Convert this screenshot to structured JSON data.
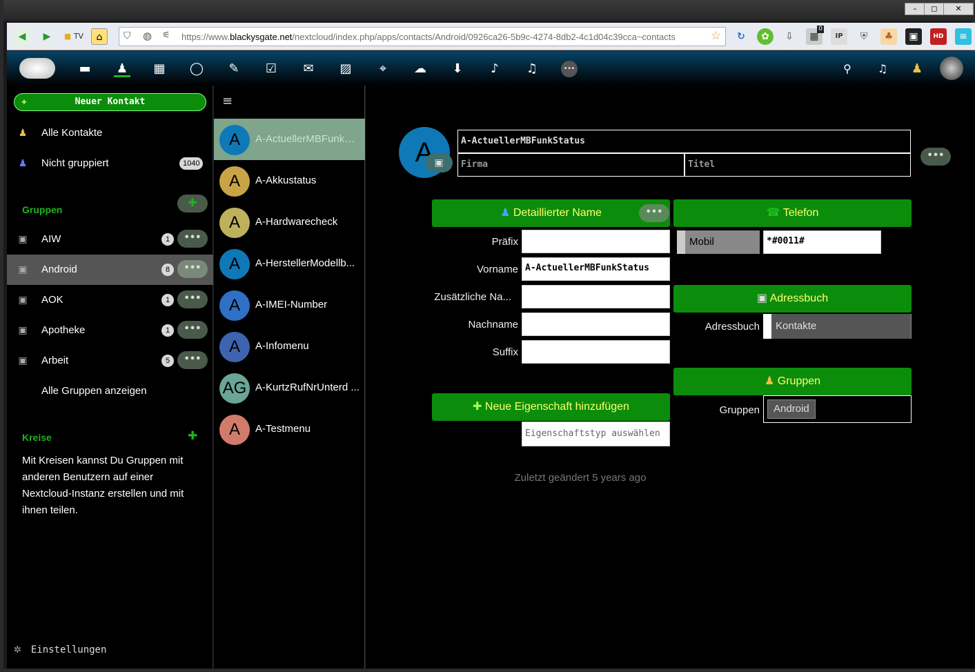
{
  "window": {
    "minimize": "–",
    "maximize": "◻",
    "close": "✕"
  },
  "browser": {
    "tv_label": "TV",
    "url_prefix": "https://www.",
    "url_host": "blackysgate.net",
    "url_path": "/nextcloud/index.php/apps/contacts/Android/0926ca26-5b9c-4274-8db2-4c1d04c39cca~contacts",
    "badge_count": "0",
    "ip_label": "IP",
    "hd_label": "HD"
  },
  "header": {
    "nav_icons": [
      "files-icon",
      "contacts-icon",
      "calendar-icon",
      "talk-icon",
      "notes-icon",
      "tasks-icon",
      "mail-icon",
      "photos-icon",
      "maps-icon",
      "upload-icon",
      "download-icon",
      "audio-icon",
      "music-icon",
      "more-icon"
    ],
    "more_label": "•••"
  },
  "sidebar": {
    "new_contact": "Neuer Kontakt",
    "all_contacts": "Alle Kontakte",
    "ungrouped": "Nicht gruppiert",
    "ungrouped_count": "1040",
    "groups_title": "Gruppen",
    "groups": [
      {
        "label": "AIW",
        "count": "1"
      },
      {
        "label": "Android",
        "count": "8"
      },
      {
        "label": "AOK",
        "count": "1"
      },
      {
        "label": "Apotheke",
        "count": "1"
      },
      {
        "label": "Arbeit",
        "count": "5"
      }
    ],
    "show_all_groups": "Alle Gruppen anzeigen",
    "circles_title": "Kreise",
    "circles_text": "Mit Kreisen kannst Du Gruppen mit anderen Benutzern auf einer Nextcloud-Instanz erstellen und mit ihnen teilen.",
    "settings": "Einstellungen",
    "dots": "•••"
  },
  "contacts": [
    {
      "initials": "A",
      "name": "A-ActuellerMBFunkSt...",
      "color": "#0e79b6"
    },
    {
      "initials": "A",
      "name": "A-Akkustatus",
      "color": "#c9a446"
    },
    {
      "initials": "A",
      "name": "A-Hardwarecheck",
      "color": "#bdb15c"
    },
    {
      "initials": "A",
      "name": "A-HerstellerModellb...",
      "color": "#0e79b6"
    },
    {
      "initials": "A",
      "name": "A-IMEI-Number",
      "color": "#2f6fc6"
    },
    {
      "initials": "A",
      "name": "A-Infomenu",
      "color": "#3e64b0"
    },
    {
      "initials": "AG",
      "name": "A-KurtzRufNrUnterd ...",
      "color": "#6aa596"
    },
    {
      "initials": "A",
      "name": "A-Testmenu",
      "color": "#d17c6a"
    }
  ],
  "detail": {
    "avatar_initial": "A",
    "full_name": "A-ActuellerMBFunkStatus",
    "company_placeholder": "Firma",
    "title_placeholder": "Titel",
    "dots": "•••",
    "detailed_name_title": "Detaillierter Name",
    "prefix_label": "Präfix",
    "prefix_value": "",
    "firstname_label": "Vorname",
    "firstname_value": "A-ActuellerMBFunkStatus",
    "additional_label": "Zusätzliche Na...",
    "additional_value": "",
    "lastname_label": "Nachname",
    "lastname_value": "",
    "suffix_label": "Suffix",
    "suffix_value": "",
    "add_property": "Neue Eigenschaft hinzufügen",
    "property_type_placeholder": "Eigenschaftstyp auswählen",
    "phone_title": "Telefon",
    "phone_type": "Mobil",
    "phone_value": "*#0011#",
    "addressbook_title": "Adressbuch",
    "addressbook_label": "Adressbuch",
    "addressbook_value": "Kontakte",
    "groups_title": "Gruppen",
    "groups_label": "Gruppen",
    "group_tag": "Android",
    "last_modified": "Zuletzt geändert 5 years ago"
  }
}
